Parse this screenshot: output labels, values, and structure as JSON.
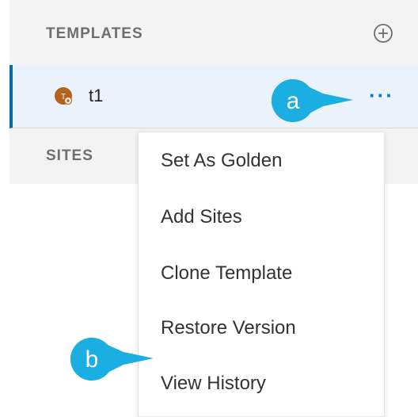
{
  "templates": {
    "header": "TEMPLATES",
    "items": [
      {
        "name": "t1"
      }
    ]
  },
  "sites": {
    "header": "SITES"
  },
  "menu": {
    "items": [
      "Set As Golden",
      "Add Sites",
      "Clone Template",
      "Restore Version",
      "View History"
    ]
  },
  "callouts": {
    "a": "a",
    "b": "b"
  },
  "icons": {
    "add": "plus-circle-icon",
    "more": "more-horizontal-icon",
    "template": "template-avatar-icon"
  },
  "colors": {
    "accent": "#0a6aa8",
    "callout": "#1aaee3",
    "selected_row": "#eaf3fb"
  }
}
